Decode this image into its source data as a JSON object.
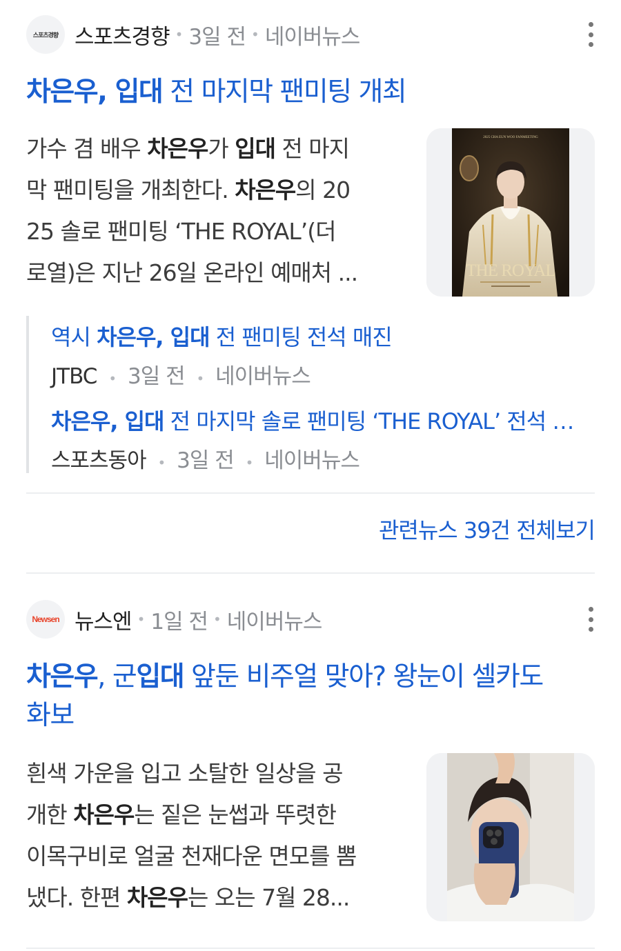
{
  "articles": [
    {
      "source": "스포츠경향",
      "logo_text": "스포츠경향",
      "time": "3일 전",
      "platform": "네이버뉴스",
      "title_bold1": "차은우, 입대",
      "title_rest": " 전 마지막 팬미팅 개최",
      "body": {
        "l1a": "가수 겸 배우 ",
        "l1b": "차은우",
        "l1c": "가 ",
        "l1d": "입대",
        "l1e": " 전 마지",
        "l2a": "막 팬미팅을 개최한다. ",
        "l2b": "차은우",
        "l2c": "의 20",
        "l3": "25 솔로 팬미팅 ‘THE ROYAL’(더",
        "l4": "로열)은 지난 26일 온라인 예매처 ..."
      },
      "thumb_title": "THE ROYAL",
      "thumb_header": "2025 CHA EUN WOO FANMEETING"
    },
    {
      "source": "뉴스엔",
      "logo_text": "Newsen",
      "time": "1일 전",
      "platform": "네이버뉴스",
      "title_bold1": "차은우",
      "title_mid": ", 군",
      "title_bold2": "입대",
      "title_rest1": " 앞둔 비주얼 맞아? 왕눈이 셀카도",
      "title_rest2": "화보",
      "body": {
        "l1": "흰색 가운을 입고 소탈한 일상을 공",
        "l2a": "개한 ",
        "l2b": "차은우",
        "l2c": "는 짙은 눈썹과 뚜렷한",
        "l3": "이목구비로 얼굴 천재다운 면모를 뽐",
        "l4a": "냈다. 한편 ",
        "l4b": "차은우",
        "l4c": "는 오는 7월 28..."
      }
    }
  ],
  "related": [
    {
      "title_pre": "역시 ",
      "title_bold": "차은우, 입대",
      "title_rest": " 전 팬미팅 전석 매진",
      "source": "JTBC",
      "time": "3일 전",
      "platform": "네이버뉴스"
    },
    {
      "title_bold": "차은우, 입대",
      "title_rest": " 전 마지막 솔로 팬미팅 ‘THE ROYAL’ 전석 매진",
      "source": "스포츠동아",
      "time": "3일 전",
      "platform": "네이버뉴스"
    }
  ],
  "more_link": "관련뉴스 39건 전체보기",
  "colors": {
    "link": "#1a5fd0",
    "meta": "#8a8d92",
    "divider": "#eceef0"
  }
}
